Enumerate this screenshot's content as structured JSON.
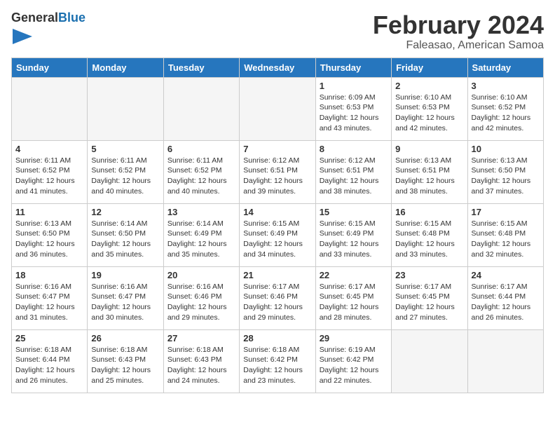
{
  "header": {
    "logo_general": "General",
    "logo_blue": "Blue",
    "title": "February 2024",
    "subtitle": "Faleasao, American Samoa"
  },
  "days_of_week": [
    "Sunday",
    "Monday",
    "Tuesday",
    "Wednesday",
    "Thursday",
    "Friday",
    "Saturday"
  ],
  "weeks": [
    [
      {
        "day": "",
        "info": ""
      },
      {
        "day": "",
        "info": ""
      },
      {
        "day": "",
        "info": ""
      },
      {
        "day": "",
        "info": ""
      },
      {
        "day": "1",
        "info": "Sunrise: 6:09 AM\nSunset: 6:53 PM\nDaylight: 12 hours\nand 43 minutes."
      },
      {
        "day": "2",
        "info": "Sunrise: 6:10 AM\nSunset: 6:53 PM\nDaylight: 12 hours\nand 42 minutes."
      },
      {
        "day": "3",
        "info": "Sunrise: 6:10 AM\nSunset: 6:52 PM\nDaylight: 12 hours\nand 42 minutes."
      }
    ],
    [
      {
        "day": "4",
        "info": "Sunrise: 6:11 AM\nSunset: 6:52 PM\nDaylight: 12 hours\nand 41 minutes."
      },
      {
        "day": "5",
        "info": "Sunrise: 6:11 AM\nSunset: 6:52 PM\nDaylight: 12 hours\nand 40 minutes."
      },
      {
        "day": "6",
        "info": "Sunrise: 6:11 AM\nSunset: 6:52 PM\nDaylight: 12 hours\nand 40 minutes."
      },
      {
        "day": "7",
        "info": "Sunrise: 6:12 AM\nSunset: 6:51 PM\nDaylight: 12 hours\nand 39 minutes."
      },
      {
        "day": "8",
        "info": "Sunrise: 6:12 AM\nSunset: 6:51 PM\nDaylight: 12 hours\nand 38 minutes."
      },
      {
        "day": "9",
        "info": "Sunrise: 6:13 AM\nSunset: 6:51 PM\nDaylight: 12 hours\nand 38 minutes."
      },
      {
        "day": "10",
        "info": "Sunrise: 6:13 AM\nSunset: 6:50 PM\nDaylight: 12 hours\nand 37 minutes."
      }
    ],
    [
      {
        "day": "11",
        "info": "Sunrise: 6:13 AM\nSunset: 6:50 PM\nDaylight: 12 hours\nand 36 minutes."
      },
      {
        "day": "12",
        "info": "Sunrise: 6:14 AM\nSunset: 6:50 PM\nDaylight: 12 hours\nand 35 minutes."
      },
      {
        "day": "13",
        "info": "Sunrise: 6:14 AM\nSunset: 6:49 PM\nDaylight: 12 hours\nand 35 minutes."
      },
      {
        "day": "14",
        "info": "Sunrise: 6:15 AM\nSunset: 6:49 PM\nDaylight: 12 hours\nand 34 minutes."
      },
      {
        "day": "15",
        "info": "Sunrise: 6:15 AM\nSunset: 6:49 PM\nDaylight: 12 hours\nand 33 minutes."
      },
      {
        "day": "16",
        "info": "Sunrise: 6:15 AM\nSunset: 6:48 PM\nDaylight: 12 hours\nand 33 minutes."
      },
      {
        "day": "17",
        "info": "Sunrise: 6:15 AM\nSunset: 6:48 PM\nDaylight: 12 hours\nand 32 minutes."
      }
    ],
    [
      {
        "day": "18",
        "info": "Sunrise: 6:16 AM\nSunset: 6:47 PM\nDaylight: 12 hours\nand 31 minutes."
      },
      {
        "day": "19",
        "info": "Sunrise: 6:16 AM\nSunset: 6:47 PM\nDaylight: 12 hours\nand 30 minutes."
      },
      {
        "day": "20",
        "info": "Sunrise: 6:16 AM\nSunset: 6:46 PM\nDaylight: 12 hours\nand 29 minutes."
      },
      {
        "day": "21",
        "info": "Sunrise: 6:17 AM\nSunset: 6:46 PM\nDaylight: 12 hours\nand 29 minutes."
      },
      {
        "day": "22",
        "info": "Sunrise: 6:17 AM\nSunset: 6:45 PM\nDaylight: 12 hours\nand 28 minutes."
      },
      {
        "day": "23",
        "info": "Sunrise: 6:17 AM\nSunset: 6:45 PM\nDaylight: 12 hours\nand 27 minutes."
      },
      {
        "day": "24",
        "info": "Sunrise: 6:17 AM\nSunset: 6:44 PM\nDaylight: 12 hours\nand 26 minutes."
      }
    ],
    [
      {
        "day": "25",
        "info": "Sunrise: 6:18 AM\nSunset: 6:44 PM\nDaylight: 12 hours\nand 26 minutes."
      },
      {
        "day": "26",
        "info": "Sunrise: 6:18 AM\nSunset: 6:43 PM\nDaylight: 12 hours\nand 25 minutes."
      },
      {
        "day": "27",
        "info": "Sunrise: 6:18 AM\nSunset: 6:43 PM\nDaylight: 12 hours\nand 24 minutes."
      },
      {
        "day": "28",
        "info": "Sunrise: 6:18 AM\nSunset: 6:42 PM\nDaylight: 12 hours\nand 23 minutes."
      },
      {
        "day": "29",
        "info": "Sunrise: 6:19 AM\nSunset: 6:42 PM\nDaylight: 12 hours\nand 22 minutes."
      },
      {
        "day": "",
        "info": ""
      },
      {
        "day": "",
        "info": ""
      }
    ]
  ]
}
